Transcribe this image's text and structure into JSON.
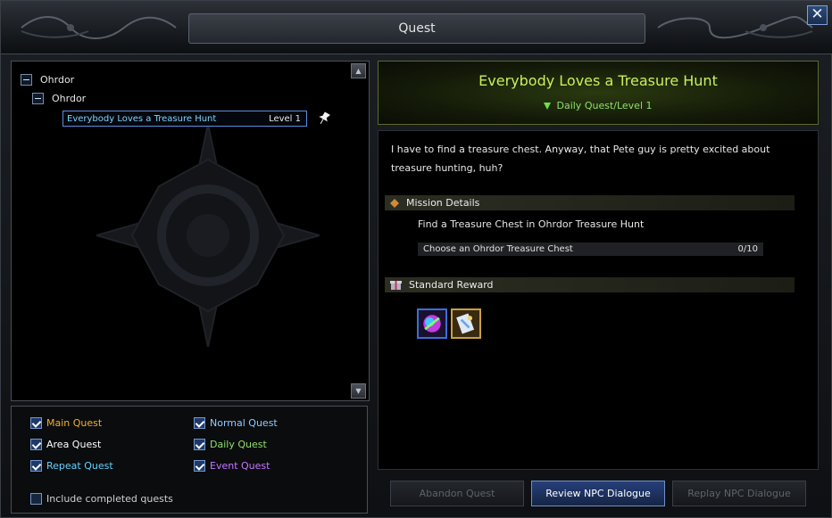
{
  "window": {
    "title": "Quest",
    "close_label": "✕"
  },
  "quest_tree": {
    "root_label": "Ohrdor",
    "child_label": "Ohrdor",
    "entry": {
      "name": "Everybody Loves a Treasure Hunt",
      "level": "Level 1"
    }
  },
  "filters": [
    {
      "label": "Main Quest",
      "checked": true,
      "color": "#f0b030"
    },
    {
      "label": "Normal Quest",
      "checked": true,
      "color": "#8fcaff"
    },
    {
      "label": "Area Quest",
      "checked": true,
      "color": "#ffffff"
    },
    {
      "label": "Daily Quest",
      "checked": true,
      "color": "#8ee06a"
    },
    {
      "label": "Repeat Quest",
      "checked": true,
      "color": "#5fd3ff"
    },
    {
      "label": "Event Quest",
      "checked": true,
      "color": "#c477ff"
    }
  ],
  "include_completed": {
    "label": "Include completed quests",
    "checked": false
  },
  "quest_detail": {
    "title": "Everybody Loves a Treasure Hunt",
    "subtitle": "Daily Quest/Level 1",
    "description": "I have to find a treasure chest. Anyway, that Pete guy is pretty excited about treasure hunting, huh?",
    "mission_header": "Mission Details",
    "mission_text": "Find a Treasure Chest in Ohrdor Treasure Hunt",
    "objective": {
      "label": "Choose an Ohrdor Treasure Chest",
      "progress": "0/10"
    },
    "reward_header": "Standard Reward"
  },
  "buttons": {
    "abandon": "Abandon Quest",
    "review": "Review NPC Dialogue",
    "replay": "Replay NPC Dialogue"
  },
  "colors": {
    "quest_title": "#c9ef5a",
    "daily_subtitle": "#8ee06a",
    "selected_entry": "#7fd3ff"
  }
}
